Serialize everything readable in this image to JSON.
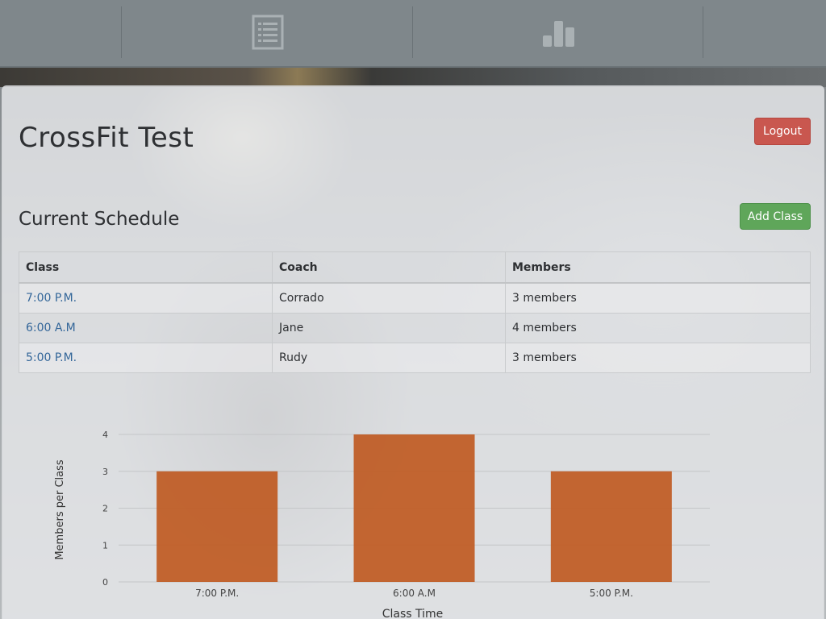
{
  "nav": {
    "items": [
      {
        "icon": "list-icon"
      },
      {
        "icon": "bar-chart-icon"
      }
    ]
  },
  "header": {
    "title": "CrossFit Test",
    "logout_label": "Logout"
  },
  "schedule": {
    "title": "Current Schedule",
    "add_label": "Add Class",
    "columns": [
      "Class",
      "Coach",
      "Members"
    ],
    "rows": [
      {
        "class": "7:00 P.M.",
        "coach": "Corrado",
        "members": "3 members"
      },
      {
        "class": "6:00 A.M",
        "coach": "Jane",
        "members": "4 members"
      },
      {
        "class": "5:00 P.M.",
        "coach": "Rudy",
        "members": "3 members"
      }
    ]
  },
  "colors": {
    "bar": "#bf5a22",
    "logout": "#c9574f",
    "add": "#5fa65a",
    "link": "#336699"
  },
  "chart_data": {
    "type": "bar",
    "categories": [
      "7:00 P.M.",
      "6:00 A.M",
      "5:00 P.M."
    ],
    "values": [
      3,
      4,
      3
    ],
    "xlabel": "Class Time",
    "ylabel": "Members per Class",
    "ylim": [
      0,
      4
    ],
    "yticks": [
      0,
      1,
      2,
      3,
      4
    ],
    "grid": true
  }
}
